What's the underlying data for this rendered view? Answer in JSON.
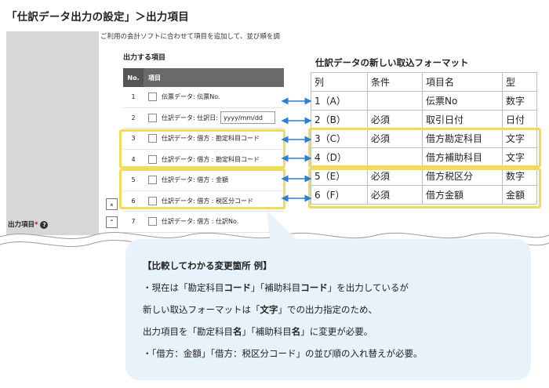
{
  "page_title": "「仕訳データ出力の設定」＞出力項目",
  "left_panel": {
    "top_note": "ご利用の会計ソフトに合わせて項目を追加して、並び順を調",
    "section_label": "出力する項目",
    "field_label": "出力項目",
    "required_mark": "*",
    "help_icon": "?",
    "header": {
      "no": "No.",
      "item": "項目"
    },
    "rows": [
      {
        "no": "1",
        "label": "伝票データ: 伝票No."
      },
      {
        "no": "2",
        "label": "仕訳データ: 仕訳日:",
        "date_value": "yyyy/mm/dd"
      },
      {
        "no": "3",
        "label": "仕訳データ: 借方 : 勘定科目コード"
      },
      {
        "no": "4",
        "label": "仕訳データ: 借方 : 勘定科目コード"
      },
      {
        "no": "5",
        "label": "仕訳データ: 借方 : 金額"
      },
      {
        "no": "6",
        "label": "仕訳データ: 借方 : 税区分コード"
      },
      {
        "no": "7",
        "label": "仕訳データ: 借方 : 仕訳No."
      }
    ],
    "move_top_icon": "⌅",
    "move_up_icon": "⌃"
  },
  "right_panel": {
    "title": "仕訳データの新しい取込フォーマット",
    "headers": [
      "列",
      "条件",
      "項目名",
      "型"
    ],
    "rows": [
      [
        "1（A）",
        "",
        "伝票No",
        "数字"
      ],
      [
        "2（B）",
        "必須",
        "取引日付",
        "日付"
      ],
      [
        "3（C）",
        "必須",
        "借方勘定科目",
        "文字"
      ],
      [
        "4（D）",
        "",
        "借方補助科目",
        "文字"
      ],
      [
        "5（E）",
        "必須",
        "借方税区分",
        "数字"
      ],
      [
        "6（F）",
        "必須",
        "借方金額",
        "金額"
      ]
    ]
  },
  "callout": {
    "heading": "【比較してわかる変更箇所 例】",
    "line1": [
      "・現在は「勘定科目",
      "コード",
      "」「補助科目",
      "コード",
      "」を出力しているが"
    ],
    "line2": [
      "新しい取込フォーマットは「",
      "文字",
      "」での出力指定のため、"
    ],
    "line3": [
      "出力項目を「勘定科目",
      "名",
      "」「補助科目",
      "名",
      "」に変更が必要。"
    ],
    "line4": "・「借方：金額」「借方：税区分コード」の並び順の入れ替えが必要。"
  },
  "colors": {
    "highlight": "#f3db5a",
    "arrow": "#2b7fd4",
    "callout_bg": "#e8f2fb",
    "header_bg": "#6a6a6a"
  }
}
